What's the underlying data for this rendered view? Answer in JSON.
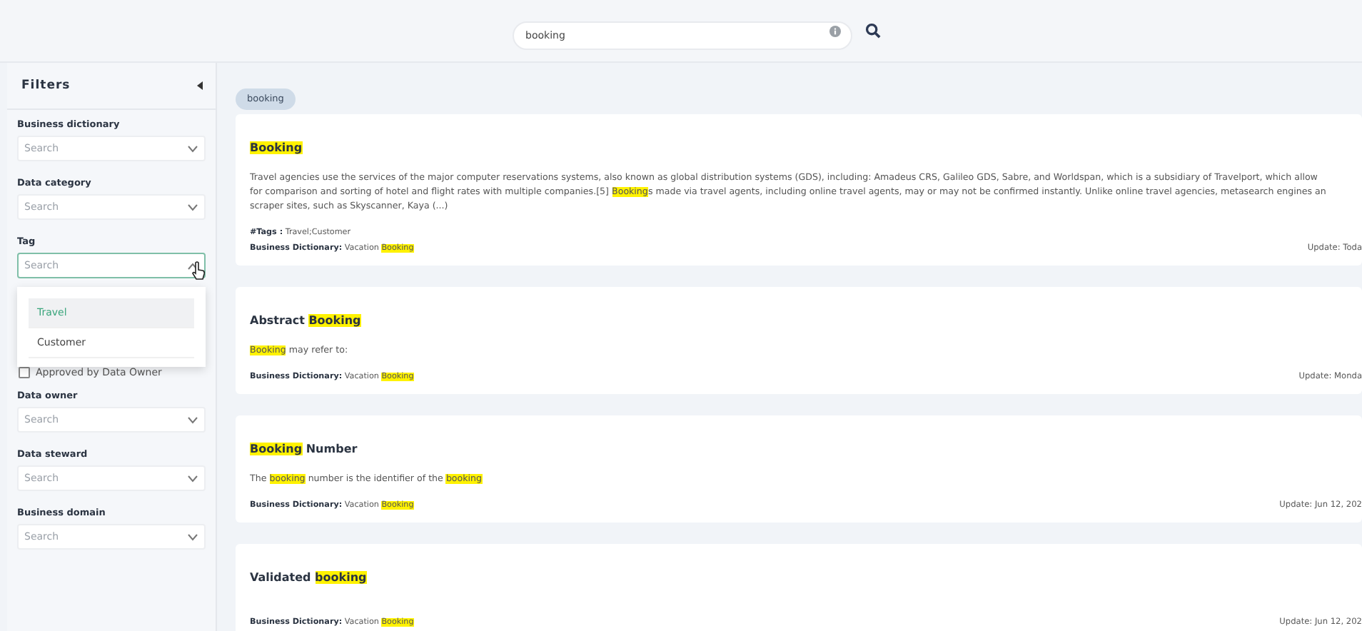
{
  "search": {
    "value": "booking"
  },
  "filters": {
    "title": "Filters",
    "fields": [
      {
        "kind": "select",
        "label": "Business dictionary",
        "placeholder": "Search",
        "expanded": false
      },
      {
        "kind": "select",
        "label": "Data category",
        "placeholder": "Search",
        "expanded": false
      },
      {
        "kind": "select",
        "label": "Tag",
        "placeholder": "Search",
        "expanded": true,
        "options": [
          {
            "label": "Travel",
            "selected": true
          },
          {
            "label": "Customer",
            "selected": false
          }
        ]
      },
      {
        "kind": "checkbox",
        "label": "Approved by Data Owner",
        "checked": false
      },
      {
        "kind": "select",
        "label": "Data owner",
        "placeholder": "Search",
        "expanded": false
      },
      {
        "kind": "select",
        "label": "Data steward",
        "placeholder": "Search",
        "expanded": false
      },
      {
        "kind": "select",
        "label": "Business domain",
        "placeholder": "Search",
        "expanded": false
      }
    ]
  },
  "chips": [
    "booking"
  ],
  "results": [
    {
      "title": [
        {
          "t": "Booking",
          "hl": true
        }
      ],
      "body": [
        [
          {
            "t": "Travel agencies use the services of the major computer reservations systems, also known as global distribution systems (GDS), including: Amadeus CRS, Galileo GDS, Sabre, and Worldspan, which is a subsidiary of Travelport, which allow",
            "hl": false
          }
        ],
        [
          {
            "t": "for comparison and sorting of hotel and flight rates with multiple companies.[5] ",
            "hl": false
          },
          {
            "t": "Booking",
            "hl": true
          },
          {
            "t": "s made via travel agents, including online travel agents, may or may not be confirmed instantly. Unlike online travel agencies, metasearch engines an",
            "hl": false
          }
        ],
        [
          {
            "t": "scraper sites, such as Skyscanner, Kaya  (...)",
            "hl": false
          }
        ]
      ],
      "tags": {
        "label": "#Tags :",
        "value": "Travel;Customer"
      },
      "dictionary": {
        "label": "Business Dictionary:",
        "value": [
          {
            "t": "Vacation ",
            "hl": false
          },
          {
            "t": "Booking",
            "hl": true
          }
        ]
      },
      "update": "Update:  Toda"
    },
    {
      "title": [
        {
          "t": "Abstract ",
          "hl": false
        },
        {
          "t": "Booking",
          "hl": true
        }
      ],
      "body": [
        [
          {
            "t": "Booking",
            "hl": true
          },
          {
            "t": " may refer to:",
            "hl": false
          }
        ]
      ],
      "dictionary": {
        "label": "Business Dictionary:",
        "value": [
          {
            "t": "Vacation ",
            "hl": false
          },
          {
            "t": "Booking",
            "hl": true
          }
        ]
      },
      "update": "Update:  Monda"
    },
    {
      "title": [
        {
          "t": "Booking",
          "hl": true
        },
        {
          "t": " Number",
          "hl": false
        }
      ],
      "body": [
        [
          {
            "t": "The ",
            "hl": false
          },
          {
            "t": "booking",
            "hl": true
          },
          {
            "t": " number is the identifier of the ",
            "hl": false
          },
          {
            "t": "booking",
            "hl": true
          }
        ]
      ],
      "dictionary": {
        "label": "Business Dictionary:",
        "value": [
          {
            "t": "Vacation ",
            "hl": false
          },
          {
            "t": "Booking",
            "hl": true
          }
        ]
      },
      "update": "Update:  Jun 12, 202"
    },
    {
      "title": [
        {
          "t": "Validated ",
          "hl": false
        },
        {
          "t": "booking",
          "hl": true
        }
      ],
      "dictionary": {
        "label": "Business Dictionary:",
        "value": [
          {
            "t": "Vacation ",
            "hl": false
          },
          {
            "t": "Booking",
            "hl": true
          }
        ]
      },
      "update": "Update:  Jun 12, 202"
    }
  ]
}
